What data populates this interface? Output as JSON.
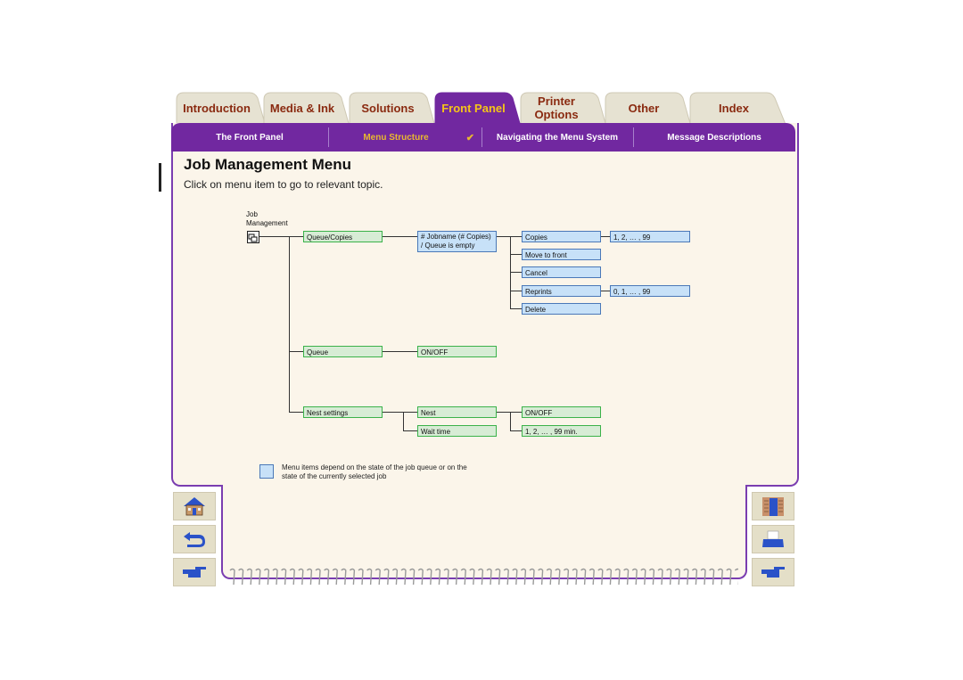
{
  "tabs": [
    {
      "label": "Introduction",
      "active": false
    },
    {
      "label": "Media & Ink",
      "active": false
    },
    {
      "label": "Solutions",
      "active": false
    },
    {
      "label": "Front Panel",
      "active": true
    },
    {
      "label": "Printer Options",
      "active": false
    },
    {
      "label": "Other",
      "active": false
    },
    {
      "label": "Index",
      "active": false
    }
  ],
  "subnav": [
    {
      "label": "The Front Panel",
      "active": false
    },
    {
      "label": "Menu Structure",
      "active": true,
      "mark": "✔"
    },
    {
      "label": "Navigating the Menu System",
      "active": false
    },
    {
      "label": "Message Descriptions",
      "active": false
    }
  ],
  "page": {
    "title": "Job Management Menu",
    "subtitle": "Click on menu item to go to relevant topic."
  },
  "diagram": {
    "root_label_line1": "Job",
    "root_label_line2": "Management",
    "queue_copies": "Queue/Copies",
    "jobname_line1": "# Jobname (# Copies)",
    "jobname_line2": "/ Queue is empty",
    "copies": "Copies",
    "copies_values": "1, 2, … , 99",
    "move_to_front": "Move to front",
    "cancel": "Cancel",
    "reprints": "Reprints",
    "reprints_values": "0, 1, … , 99",
    "delete": "Delete",
    "queue": "Queue",
    "queue_value": "ON/OFF",
    "nest_settings": "Nest settings",
    "nest": "Nest",
    "nest_value": "ON/OFF",
    "wait_time": "Wait time",
    "wait_time_values": "1, 2, … , 99 min."
  },
  "legend": {
    "text_line1": "Menu items depend on the state of the job queue or on the",
    "text_line2": "state of the currently selected job"
  },
  "nav_buttons": {
    "left": [
      "home",
      "back",
      "next"
    ],
    "right": [
      "exit",
      "print",
      "next-page"
    ]
  },
  "colors": {
    "purple": "#7128a0",
    "active_tab_text": "#f5c518",
    "tab_text": "#8a2a10",
    "panel_bg": "#fbf5ea",
    "green_node": "#d7ecd5",
    "blue_node": "#c7e1f8"
  }
}
